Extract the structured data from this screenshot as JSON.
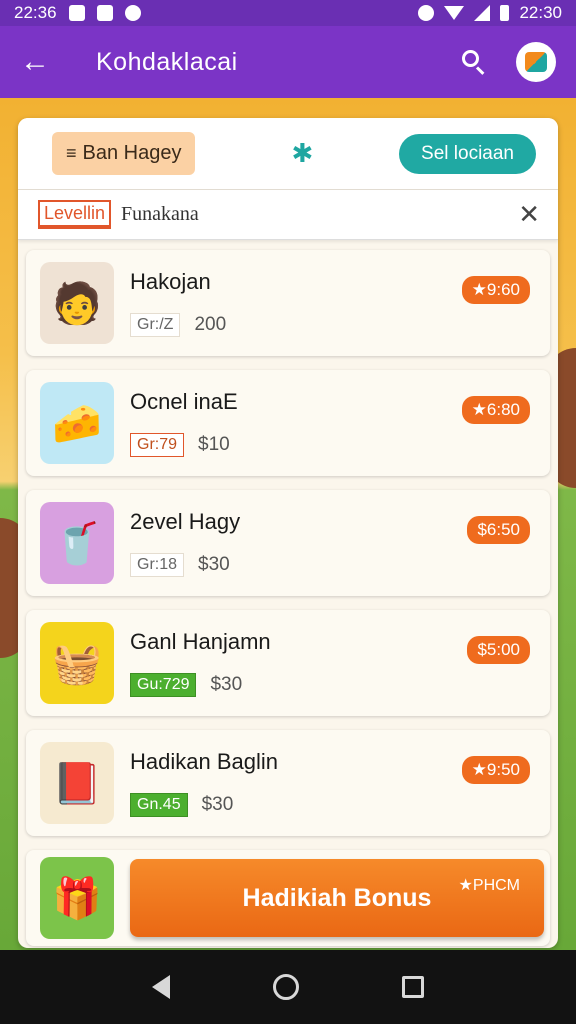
{
  "status_bar": {
    "time_left": "22:36",
    "time_right": "22:30"
  },
  "app_bar": {
    "title": "Kohdaklacai",
    "back_icon": "arrow-left-icon",
    "search_icon": "search-icon"
  },
  "toolbar": {
    "chip_label": "Ban Hagey",
    "pill_label": "Sel lociaan"
  },
  "filter": {
    "tag": "Levellin",
    "text": "Funakana"
  },
  "items": [
    {
      "name": "Hakojan",
      "badge": "Gr:/Z",
      "value": "200",
      "price": "9:60",
      "badge_style": "plain",
      "thumb_bg": "#efe2d4",
      "thumb": "🧑"
    },
    {
      "name": "Ocnel inaE",
      "badge": "Gr:79",
      "value": "$10",
      "price": "6:80",
      "badge_style": "orange",
      "thumb_bg": "#bfe8f5",
      "thumb": "🧀"
    },
    {
      "name": "2evel Hagy",
      "badge": "Gr:18",
      "value": "$30",
      "price": "6:50",
      "badge_style": "plain",
      "thumb_bg": "#d8a0e0",
      "thumb": "🥤"
    },
    {
      "name": "Ganl Hanjamn",
      "badge": "Gu:729",
      "value": "$30",
      "price": "5:00",
      "badge_style": "green",
      "thumb_bg": "#f4d41c",
      "thumb": "🧺"
    },
    {
      "name": "Hadikan Baglin",
      "badge": "Gn.45",
      "value": "$30",
      "price": "9:50",
      "badge_style": "green",
      "thumb_bg": "#f6ead0",
      "thumb": "📕"
    }
  ],
  "bonus": {
    "label": "Hadikiah Bonus",
    "corner": "PHCM"
  }
}
